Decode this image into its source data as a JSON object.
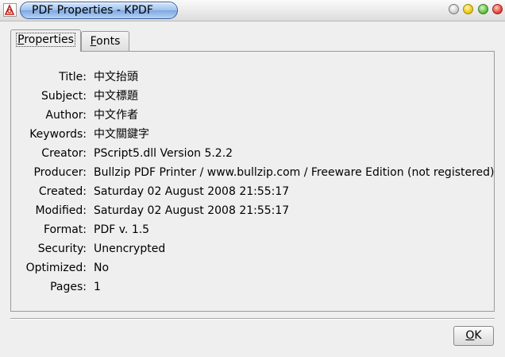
{
  "window": {
    "title": "PDF Properties - KPDF",
    "icon": "pdf-document-icon",
    "buttons": [
      "window-gray-icon",
      "window-yellow-icon",
      "window-green-icon",
      "window-red-icon"
    ]
  },
  "tabs": [
    {
      "prefix": "",
      "accel": "P",
      "rest": "roperties",
      "active": true
    },
    {
      "prefix": "",
      "accel": "F",
      "rest": "onts",
      "active": false
    }
  ],
  "properties": [
    {
      "label": "Title:",
      "value": "中文抬頭"
    },
    {
      "label": "Subject:",
      "value": "中文標題"
    },
    {
      "label": "Author:",
      "value": "中文作者"
    },
    {
      "label": "Keywords:",
      "value": "中文關鍵字"
    },
    {
      "label": "Creator:",
      "value": "PScript5.dll Version 5.2.2"
    },
    {
      "label": "Producer:",
      "value": "Bullzip PDF Printer / www.bullzip.com / Freeware Edition (not registered)"
    },
    {
      "label": "Created:",
      "value": "Saturday 02 August 2008 21:55:17"
    },
    {
      "label": "Modified:",
      "value": "Saturday 02 August 2008 21:55:17"
    },
    {
      "label": "Format:",
      "value": "PDF v. 1.5"
    },
    {
      "label": "Security:",
      "value": "Unencrypted"
    },
    {
      "label": "Optimized:",
      "value": "No"
    },
    {
      "label": "Pages:",
      "value": "1"
    }
  ],
  "ok_button": {
    "accel": "O",
    "rest": "K"
  }
}
